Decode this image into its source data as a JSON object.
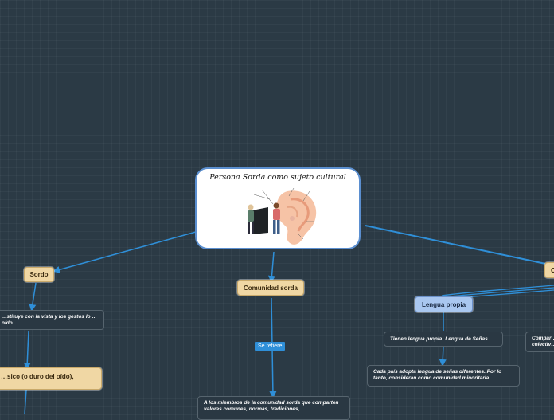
{
  "colors": {
    "background": "#2b3a45",
    "link": "#2f8fd8",
    "tan_node": "#f0d7a4",
    "blue_node": "#a9c7f0",
    "dark_node": "#2a3843"
  },
  "central": {
    "title": "Persona Sorda como sujeto cultural",
    "image": "illustration of two people beside a large ear"
  },
  "nodes": {
    "sordo": "Sordo",
    "sordo_note": "…stituye con la vista y los gestos lo … oído.",
    "sordo_child": "…sico (o duro del oído),",
    "comunidad": "Comunidad sorda",
    "se_refiere": "Se refiere",
    "comunidad_desc": "A los miembros de la comunidad sorda que comparten valores comunes, normas, tradiciones,",
    "lengua_propia": "Lengua propia",
    "lengua_senas": "Tienen lengua propia: Lengua de Señas",
    "cada_pais": "Cada país adopta lengua de señas diferentes. Por lo tanto, consideran como comunidad minoritaria.",
    "right_node": "C…",
    "right_dark": "Compar… colectiv…"
  }
}
